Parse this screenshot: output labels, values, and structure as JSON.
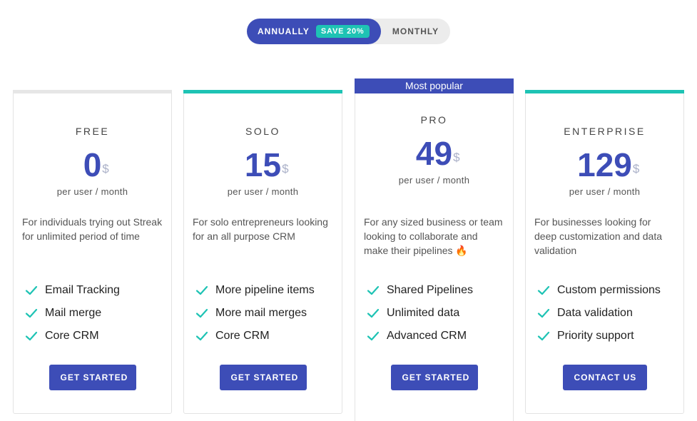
{
  "billing_toggle": {
    "annually_label": "ANNUALLY",
    "save_badge": "SAVE 20%",
    "monthly_label": "MONTHLY",
    "selected": "ANNUALLY"
  },
  "colors": {
    "accent": "#3d4db7",
    "teal": "#1ec3b4",
    "check": "#1ec3b4"
  },
  "plans": [
    {
      "name": "FREE",
      "price": "0",
      "currency": "$",
      "per": "per user / month",
      "description": "For individuals trying out Streak for unlimited period of time",
      "features": [
        "Email Tracking",
        "Mail merge",
        "Core CRM"
      ],
      "cta": "GET STARTED"
    },
    {
      "name": "SOLO",
      "price": "15",
      "currency": "$",
      "per": "per user / month",
      "description": "For solo entrepreneurs looking for an all purpose CRM",
      "features": [
        "More pipeline items",
        "More mail merges",
        "Core CRM"
      ],
      "cta": "GET STARTED"
    },
    {
      "badge": "Most popular",
      "name": "PRO",
      "price": "49",
      "currency": "$",
      "per": "per user / month",
      "description": "For any sized business or team looking to collaborate and make their pipelines 🔥",
      "features": [
        "Shared Pipelines",
        "Unlimited data",
        "Advanced CRM"
      ],
      "cta": "GET STARTED"
    },
    {
      "name": "ENTERPRISE",
      "price": "129",
      "currency": "$",
      "per": "per user / month",
      "description": "For businesses looking for deep customization and data validation",
      "features": [
        "Custom permissions",
        "Data validation",
        "Priority support"
      ],
      "cta": "CONTACT US"
    }
  ]
}
